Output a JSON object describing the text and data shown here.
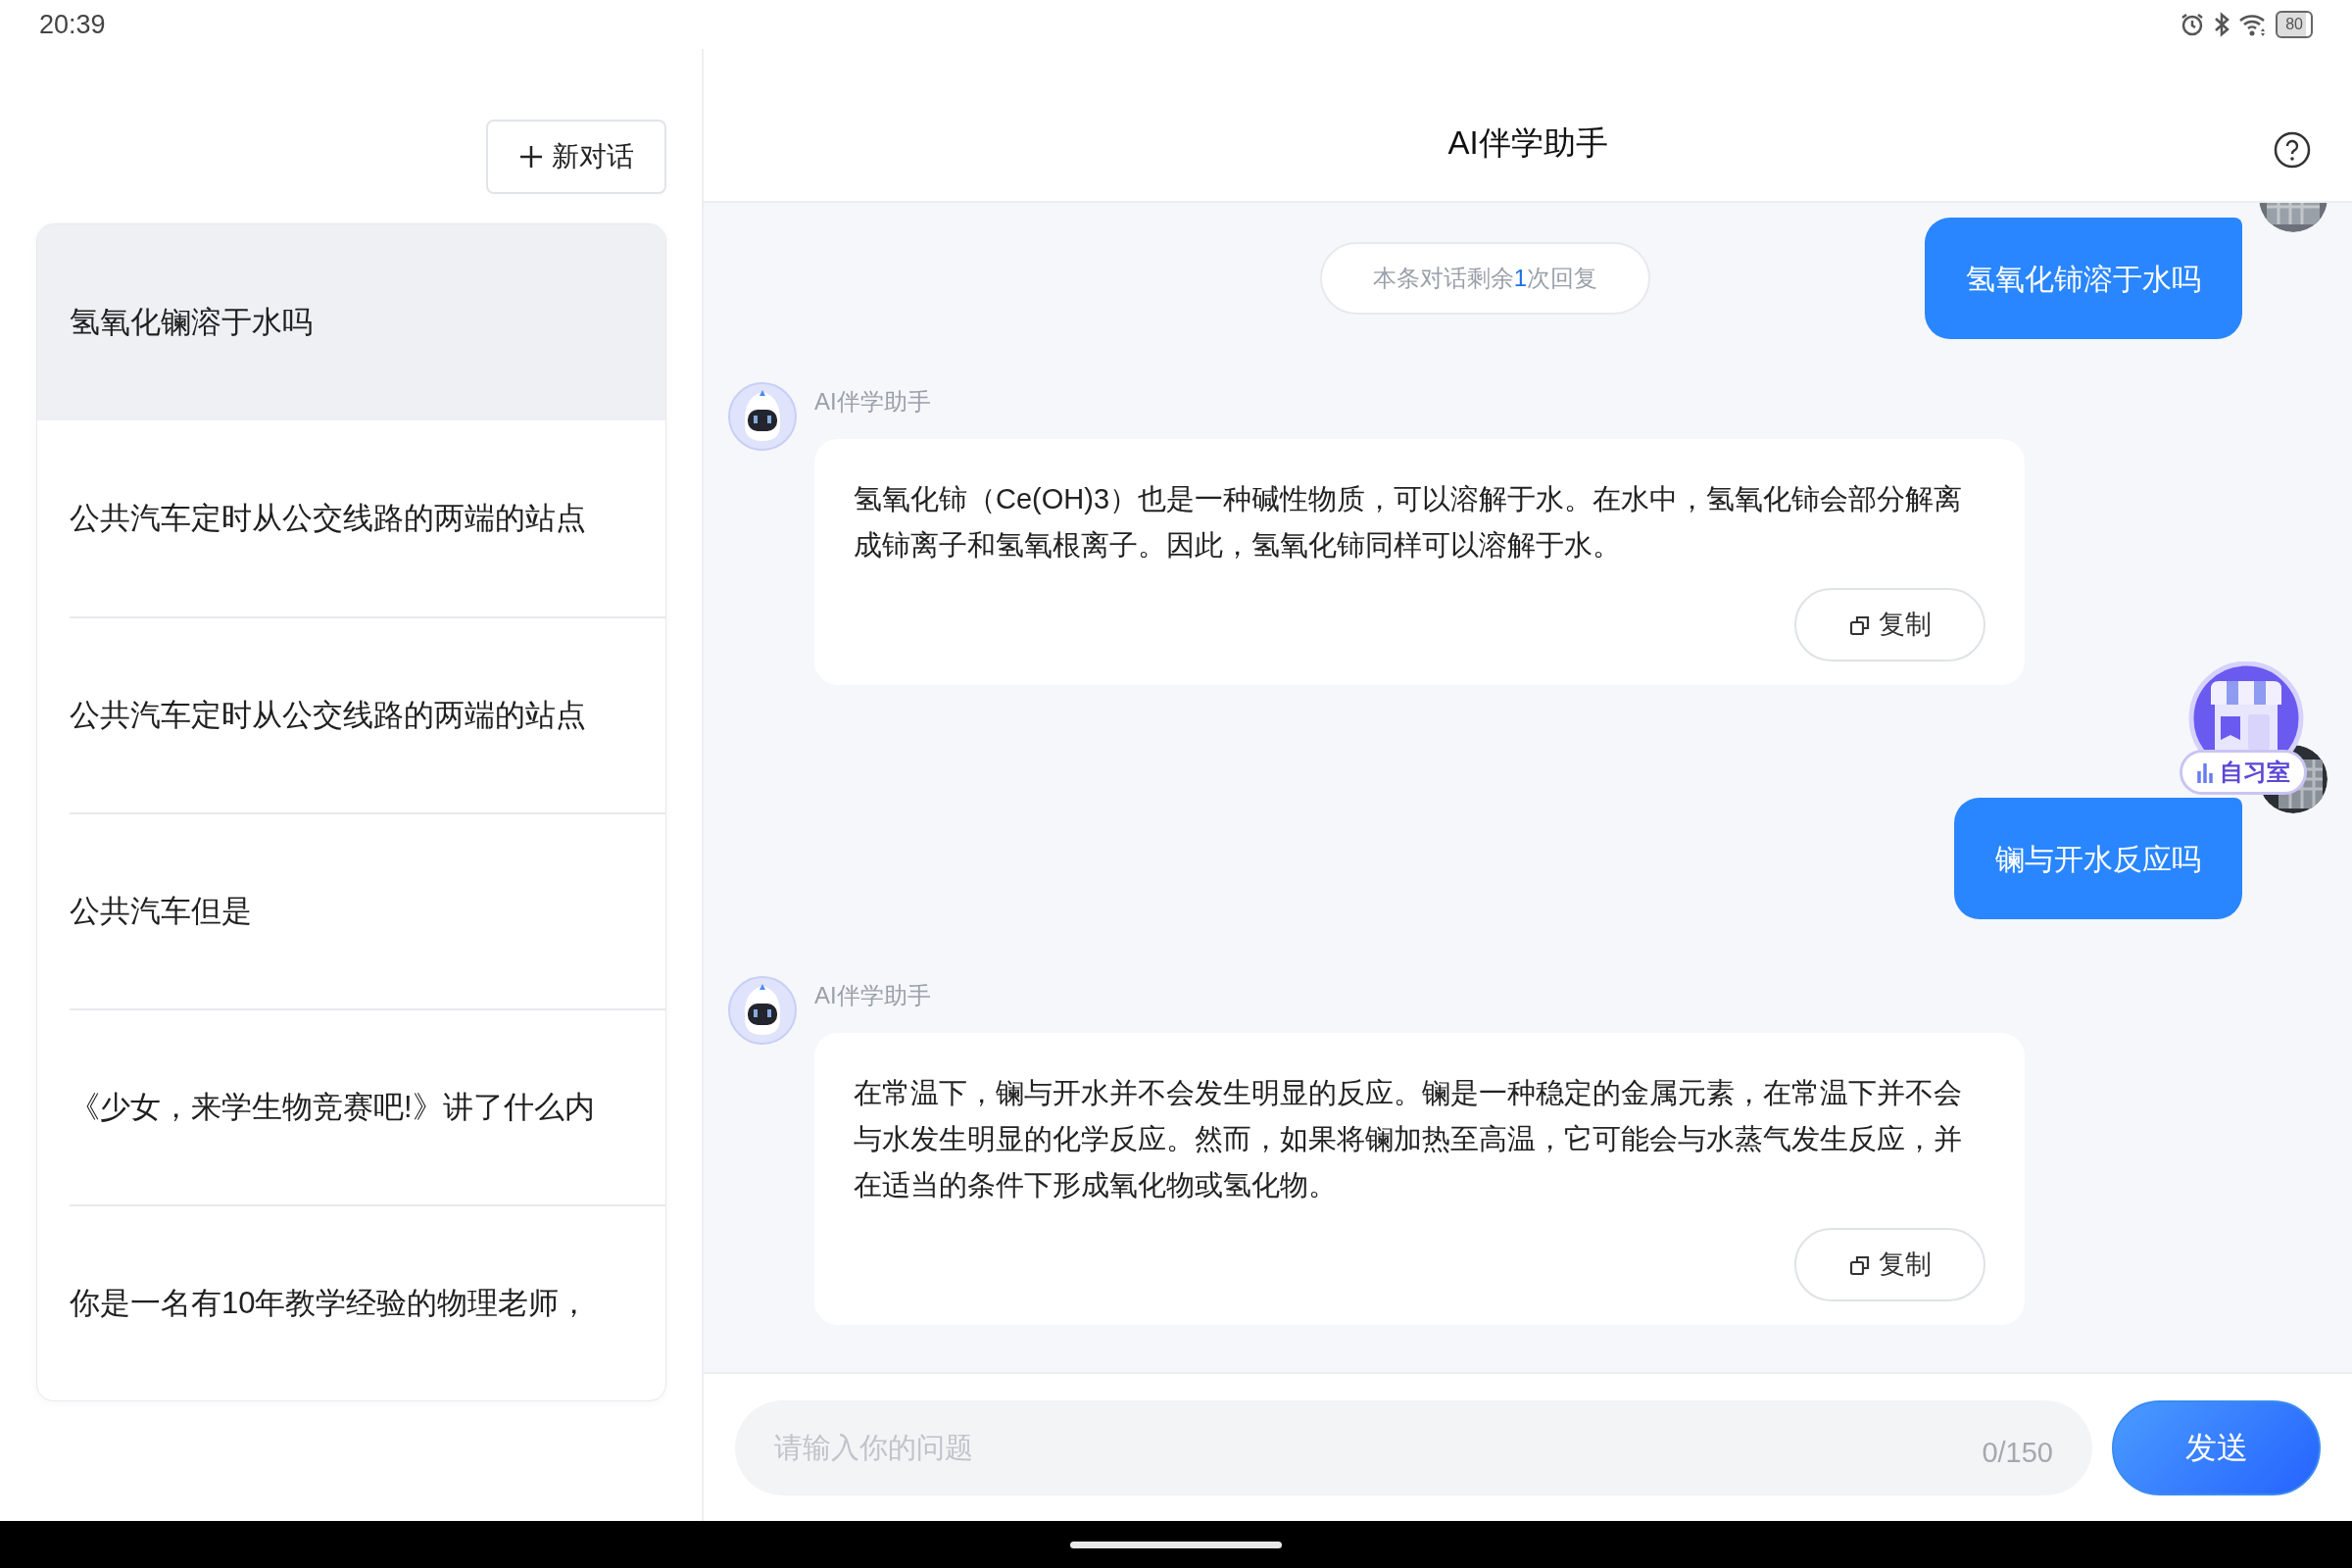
{
  "status_bar": {
    "time": "20:39",
    "battery": "80"
  },
  "sidebar": {
    "new_chat_button": "新对话",
    "conversations": [
      {
        "title": "氢氧化镧溶于水吗",
        "selected": true
      },
      {
        "title": "公共汽车定时从公交线路的两端的站点",
        "selected": false
      },
      {
        "title": "公共汽车定时从公交线路的两端的站点",
        "selected": false
      },
      {
        "title": "公共汽车但是",
        "selected": false
      },
      {
        "title": "《少女，来学生物竞赛吧!》讲了什么内",
        "selected": false
      },
      {
        "title": "你是一名有10年教学经验的物理老师，",
        "selected": false
      }
    ]
  },
  "header": {
    "title": "AI伴学助手"
  },
  "quota_notice": {
    "prefix": "本条对话剩余",
    "count": "1",
    "suffix": "次回复"
  },
  "messages": [
    {
      "kind": "user",
      "text": "氢氧化铈溶于水吗"
    },
    {
      "kind": "assistant",
      "name": "AI伴学助手",
      "text": "氢氧化铈（Ce(OH)3）也是一种碱性物质，可以溶解于水。在水中，氢氧化铈会部分解离成铈离子和氢氧根离子。因此，氢氧化铈同样可以溶解于水。",
      "copy_label": "复制"
    },
    {
      "kind": "user",
      "text": "镧与开水反应吗"
    },
    {
      "kind": "assistant",
      "name": "AI伴学助手",
      "text": "在常温下，镧与开水并不会发生明显的反应。镧是一种稳定的金属元素，在常温下并不会与水发生明显的化学反应。然而，如果将镧加热至高温，它可能会与水蒸气发生反应，并在适当的条件下形成氧化物或氢化物。",
      "copy_label": "复制"
    }
  ],
  "floating_widget": {
    "label": "自习室"
  },
  "composer": {
    "placeholder": "请输入你的问题",
    "counter": "0/150",
    "send_button": "发送"
  }
}
